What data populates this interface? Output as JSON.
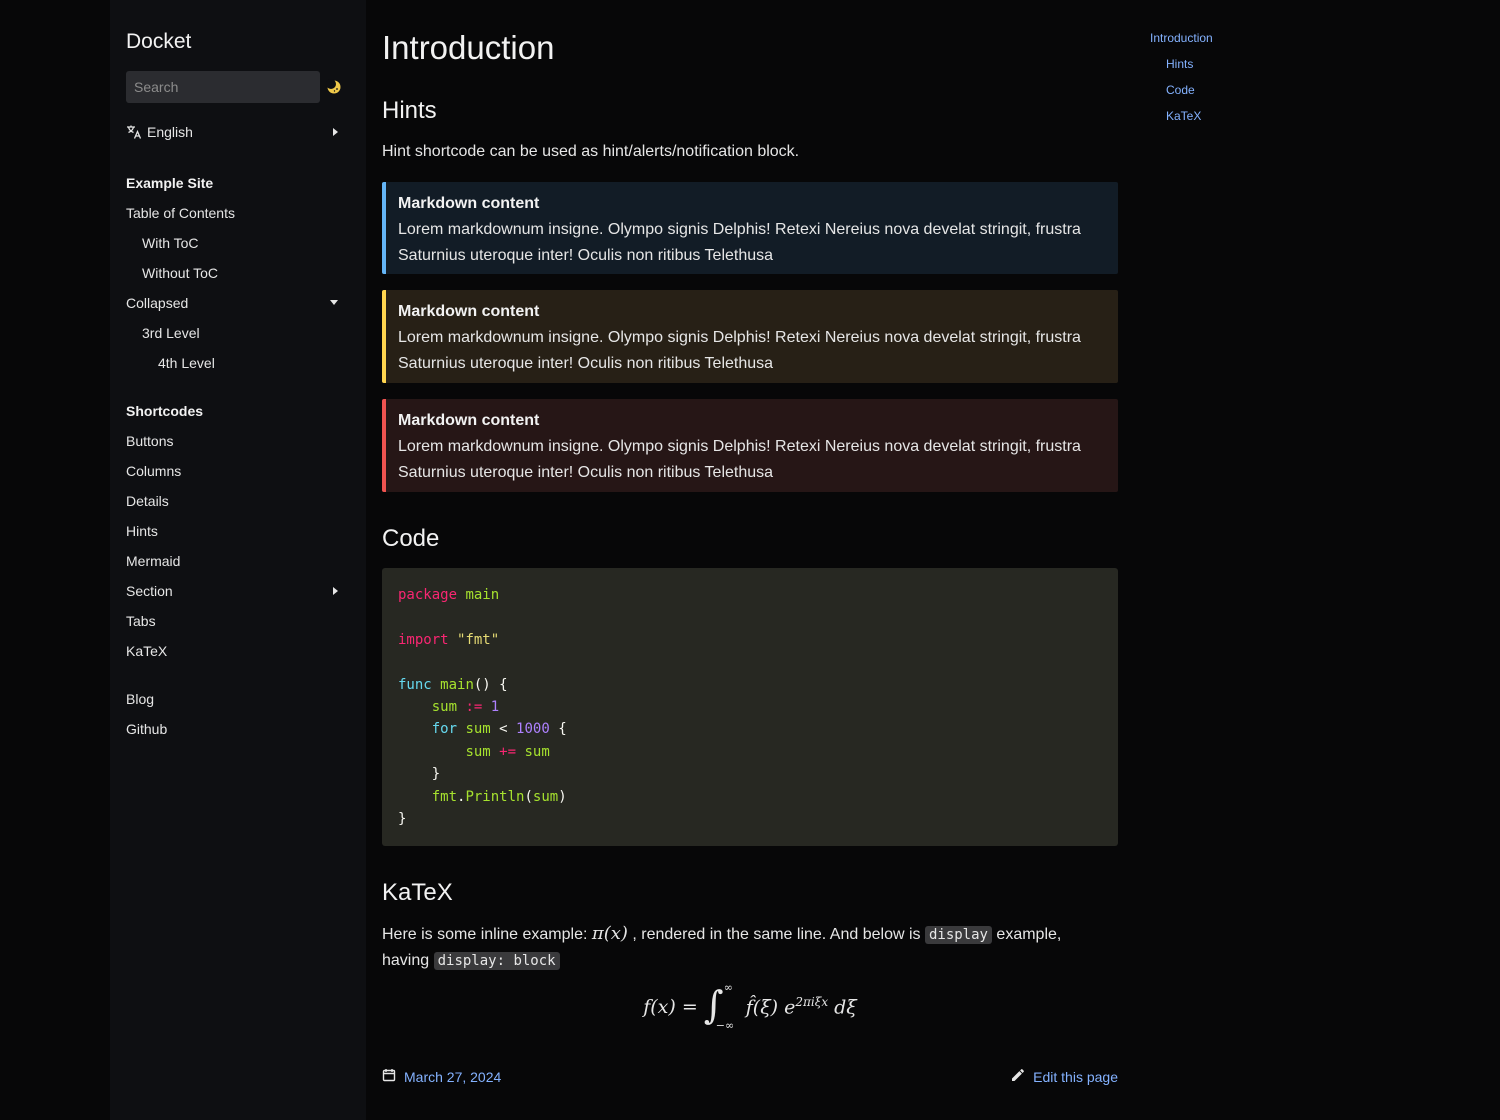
{
  "app": {
    "brand": "Docket"
  },
  "search": {
    "placeholder": "Search"
  },
  "language": {
    "label": "English"
  },
  "sidebar": {
    "sections": [
      {
        "title": "Example Site",
        "items": [
          {
            "label": "Table of Contents"
          },
          {
            "label": "With ToC"
          },
          {
            "label": "Without ToC"
          },
          {
            "label": "Collapsed"
          },
          {
            "label": "3rd Level"
          },
          {
            "label": "4th Level"
          }
        ]
      },
      {
        "title": "Shortcodes",
        "items": [
          {
            "label": "Buttons"
          },
          {
            "label": "Columns"
          },
          {
            "label": "Details"
          },
          {
            "label": "Hints"
          },
          {
            "label": "Mermaid"
          },
          {
            "label": "Section"
          },
          {
            "label": "Tabs"
          },
          {
            "label": "KaTeX"
          }
        ]
      }
    ],
    "extra": [
      {
        "label": "Blog"
      },
      {
        "label": "Github"
      }
    ]
  },
  "main": {
    "title": "Introduction",
    "hints": {
      "heading": "Hints",
      "intro": "Hint shortcode can be used as hint/alerts/notification block.",
      "blocks": [
        {
          "type": "info",
          "title": "Markdown content",
          "body": "Lorem markdownum insigne. Olympo signis Delphis! Retexi Nereius nova develat stringit, frustra Saturnius uteroque inter! Oculis non ritibus Telethusa"
        },
        {
          "type": "warning",
          "title": "Markdown content",
          "body": "Lorem markdownum insigne. Olympo signis Delphis! Retexi Nereius nova develat stringit, frustra Saturnius uteroque inter! Oculis non ritibus Telethusa"
        },
        {
          "type": "danger",
          "title": "Markdown content",
          "body": "Lorem markdownum insigne. Olympo signis Delphis! Retexi Nereius nova develat stringit, frustra Saturnius uteroque inter! Oculis non ritibus Telethusa"
        }
      ]
    },
    "code": {
      "heading": "Code",
      "lines": [
        "package main",
        "",
        "import \"fmt\"",
        "",
        "func main() {",
        "    sum := 1",
        "    for sum < 1000 {",
        "        sum += sum",
        "    }",
        "    fmt.Println(sum)",
        "}"
      ]
    },
    "katex": {
      "heading": "KaTeX",
      "text_before": "Here is some inline example: ",
      "inline_math": "π(x)",
      "text_middle": " , rendered in the same line. And below is ",
      "code_display": "display",
      "text_after": " example,",
      "text_having": "having ",
      "code_display_block": "display: block",
      "display_math": "f(x) = ∫ f̂(ξ) e^{2πiξx} dξ",
      "display_lower": "−∞",
      "display_upper": "∞",
      "display_exp": "2πiξx"
    },
    "footer": {
      "date": "March 27, 2024",
      "edit_label": "Edit this page"
    }
  },
  "toc": {
    "items": [
      {
        "label": "Introduction",
        "level": 1
      },
      {
        "label": "Hints",
        "level": 2
      },
      {
        "label": "Code",
        "level": 2
      },
      {
        "label": "KaTeX",
        "level": 2
      }
    ]
  },
  "colors": {
    "accent_link": "#84b2ff",
    "hint_info": "#64b5f6",
    "hint_warning": "#ffd54f",
    "hint_danger": "#ef5350"
  }
}
